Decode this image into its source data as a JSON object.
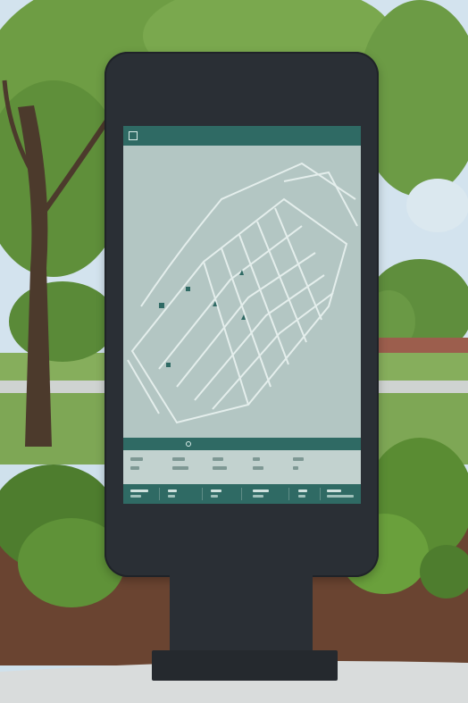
{
  "scene": {
    "sky_color": "#d3e3ee",
    "grass_color": "#7fa85a",
    "mulch_color": "#6a4431",
    "path_color": "#d9dcdc",
    "kiosk_color": "#2a2f35",
    "accent_color": "#2f6a64"
  },
  "kiosk": {
    "screen": {
      "header_icon": "map-icon",
      "footer_icon": "info-icon"
    }
  }
}
